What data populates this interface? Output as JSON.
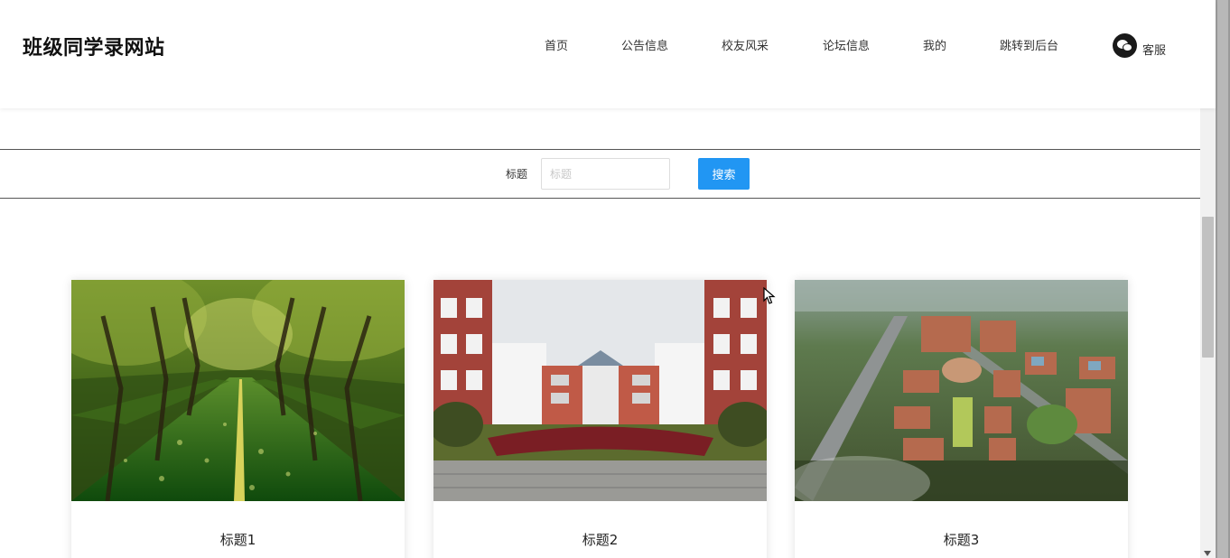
{
  "header": {
    "site_title": "班级同学录网站",
    "nav": [
      {
        "label": "首页"
      },
      {
        "label": "公告信息"
      },
      {
        "label": "校友风采"
      },
      {
        "label": "论坛信息"
      },
      {
        "label": "我的"
      },
      {
        "label": "跳转到后台"
      }
    ],
    "service_label": "客服",
    "service_icon": "wechat-icon"
  },
  "search": {
    "label": "标题",
    "placeholder": "标题",
    "value": "",
    "button_label": "搜索",
    "button_color": "#2196f3"
  },
  "cards": [
    {
      "title": "标题1",
      "image": "tree-lined-road-photo"
    },
    {
      "title": "标题2",
      "image": "campus-building-photo"
    },
    {
      "title": "标题3",
      "image": "campus-aerial-rendering"
    }
  ]
}
